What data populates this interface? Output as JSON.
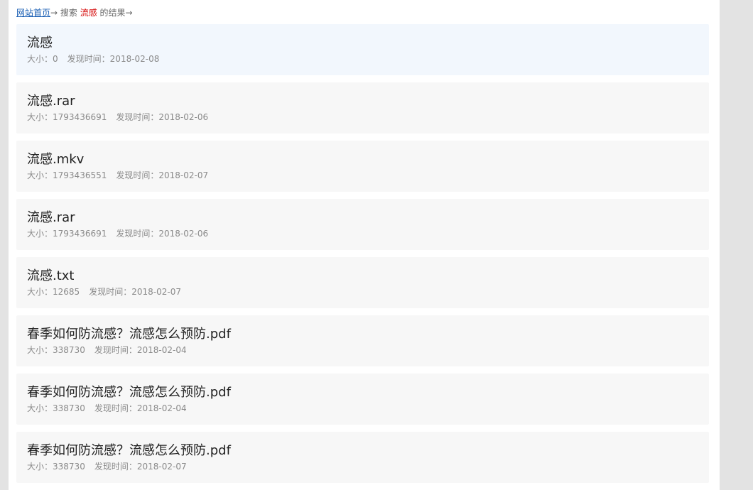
{
  "breadcrumb": {
    "home_label": "网站首页",
    "arrow1": "→ 搜索 ",
    "keyword": "流感",
    "suffix": " 的结果→"
  },
  "meta_labels": {
    "size": "大小：",
    "found": "发现时间："
  },
  "results": [
    {
      "title": "流感",
      "size": "0",
      "date": "2018-02-08",
      "highlighted": true
    },
    {
      "title": "流感.rar",
      "size": "1793436691",
      "date": "2018-02-06"
    },
    {
      "title": "流感.mkv",
      "size": "1793436551",
      "date": "2018-02-07"
    },
    {
      "title": "流感.rar",
      "size": "1793436691",
      "date": "2018-02-06"
    },
    {
      "title": "流感.txt",
      "size": "12685",
      "date": "2018-02-07"
    },
    {
      "title": "春季如何防流感？流感怎么预防.pdf",
      "size": "338730",
      "date": "2018-02-04"
    },
    {
      "title": "春季如何防流感？流感怎么预防.pdf",
      "size": "338730",
      "date": "2018-02-04"
    },
    {
      "title": "春季如何防流感？流感怎么预防.pdf",
      "size": "338730",
      "date": "2018-02-07"
    }
  ]
}
